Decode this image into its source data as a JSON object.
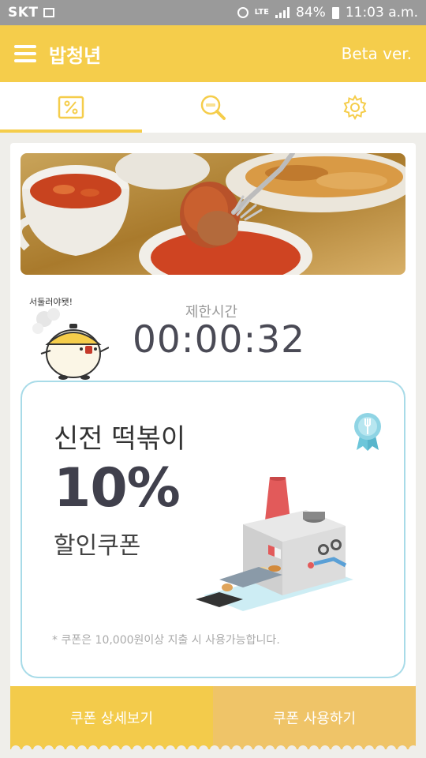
{
  "status_bar": {
    "carrier": "SKT",
    "network": "LTE",
    "battery": "84%",
    "time": "11:03 a.m."
  },
  "app_bar": {
    "title": "밥청년",
    "version": "Beta ver."
  },
  "tabs": [
    {
      "icon": "coupon-percent-icon",
      "active": true
    },
    {
      "icon": "search-magnifier-icon",
      "active": false
    },
    {
      "icon": "gear-icon",
      "active": false
    }
  ],
  "colors": {
    "accent": "#f5cd4b",
    "button_use": "#efc468",
    "coupon_border": "#a8dbe8",
    "timer_text": "#4a4a55"
  },
  "main": {
    "mascot_speech": "서둘러야됏!",
    "timer_label": "제한시간",
    "timer_value": "00:00:32"
  },
  "coupon": {
    "store": "신전 떡볶이",
    "discount": "10%",
    "type": "할인쿠폰",
    "note": "* 쿠폰은 10,000원이상 지출 시 사용가능합니다."
  },
  "buttons": {
    "detail": "쿠폰 상세보기",
    "use": "쿠폰 사용하기"
  }
}
